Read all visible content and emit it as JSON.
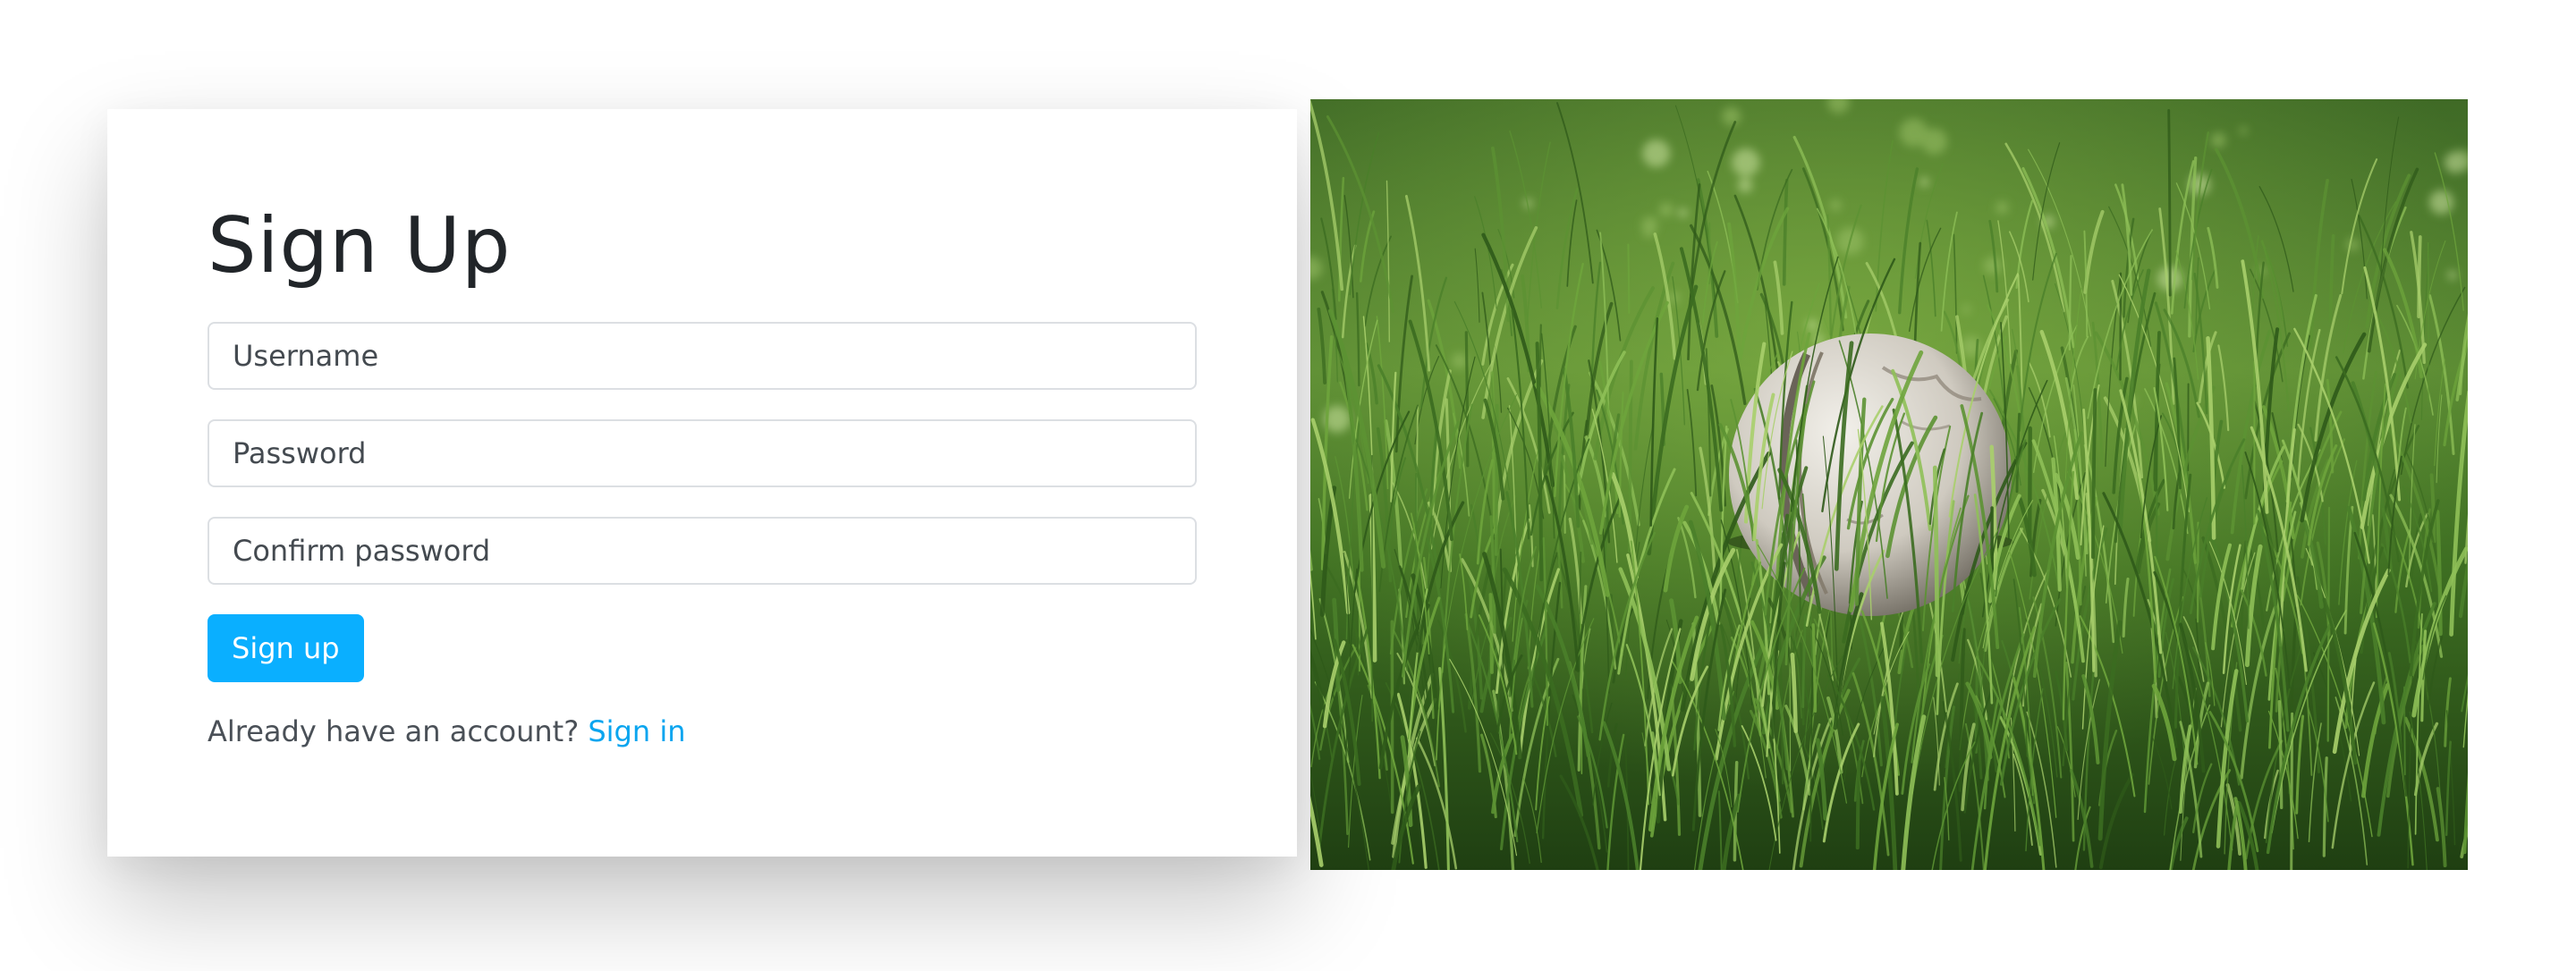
{
  "signup": {
    "title": "Sign Up",
    "username_placeholder": "Username",
    "password_placeholder": "Password",
    "confirm_placeholder": "Confirm password",
    "submit_label": "Sign up",
    "signin_prompt": "Already have an account?",
    "signin_link": "Sign in"
  },
  "colors": {
    "accent": "#0aafff",
    "link": "#0aa5ef"
  },
  "image": {
    "subject": "white leather ball resting in green grass"
  }
}
